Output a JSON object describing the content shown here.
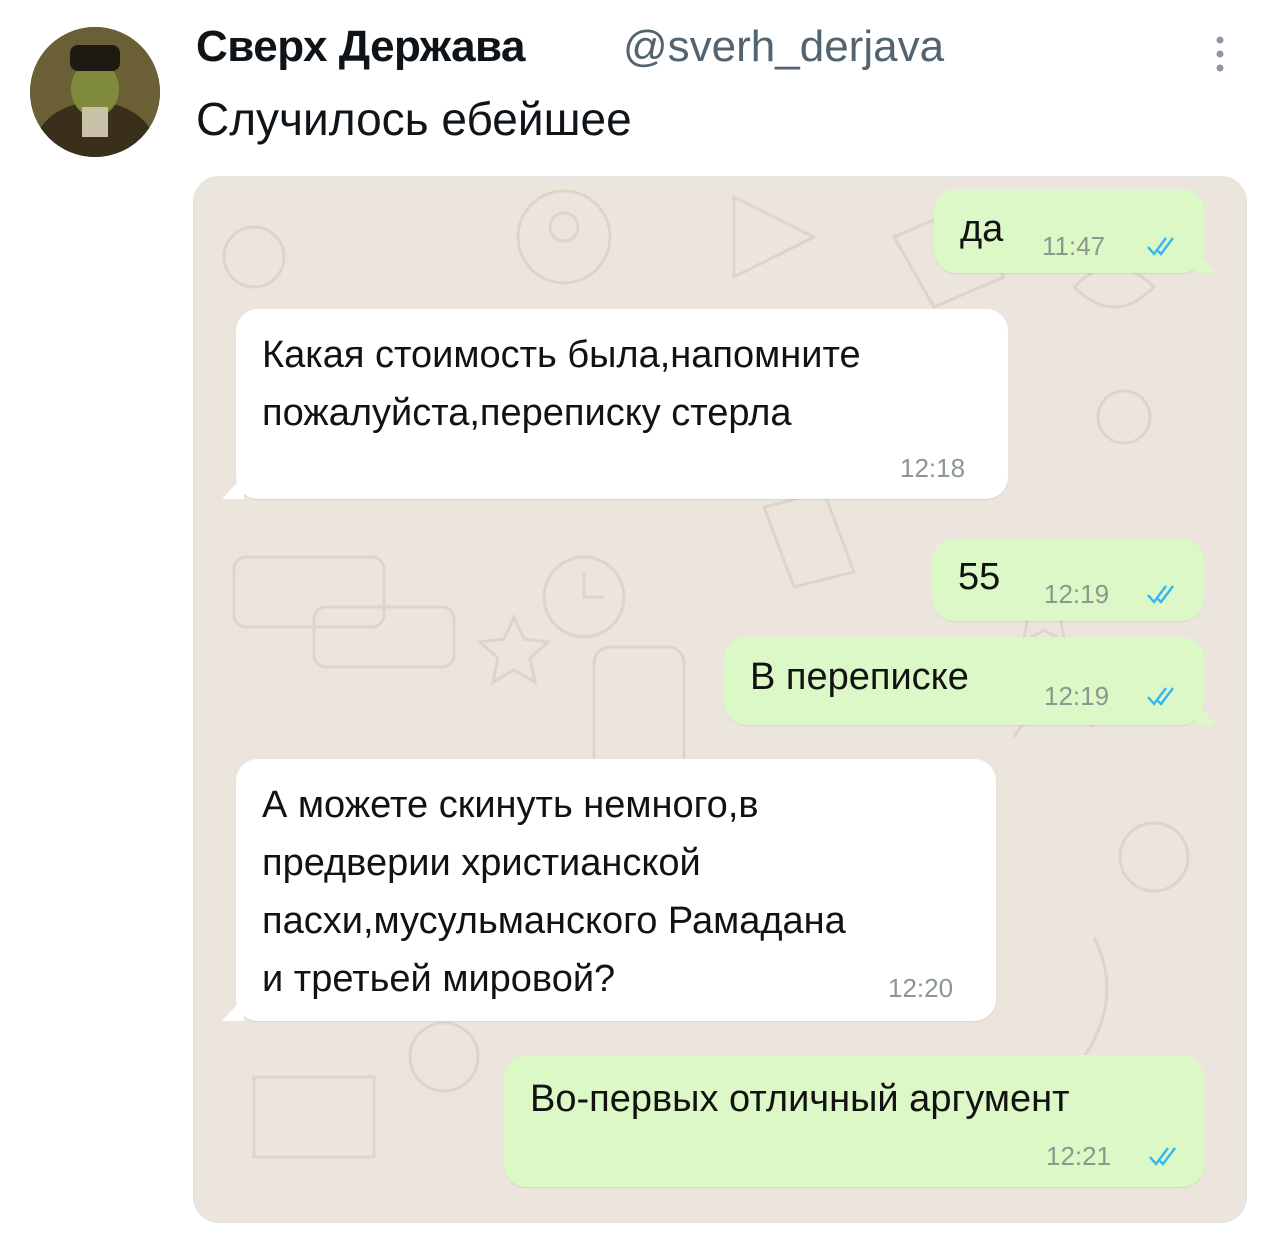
{
  "tweet": {
    "author_name": "Сверх Держава",
    "author_handle": "@sverh_derjava",
    "text": "Случилось ебейшее"
  },
  "chat": {
    "messages": [
      {
        "direction": "outgoing",
        "text": "да",
        "time": "11:47",
        "read": true
      },
      {
        "direction": "incoming",
        "lines": [
          "Какая стоимость была,напомните",
          "пожалуйста,переписку стерла"
        ],
        "time": "12:18"
      },
      {
        "direction": "outgoing",
        "text": "55",
        "time": "12:19",
        "read": true
      },
      {
        "direction": "outgoing",
        "text": "В переписке",
        "time": "12:19",
        "read": true
      },
      {
        "direction": "incoming",
        "lines": [
          "А можете скинуть немного,в",
          "предверии христианской",
          "пасхи,мусульманского Рамадана",
          "и третьей мировой?"
        ],
        "time": "12:20"
      },
      {
        "direction": "outgoing",
        "text": "Во-первых отличный аргумент",
        "time": "12:21",
        "read": true
      }
    ]
  },
  "colors": {
    "outgoing_bubble": "#dcf8c6",
    "incoming_bubble": "#ffffff",
    "read_tick": "#34b7f1",
    "wallpaper": "#ebe5dd"
  },
  "icons": [
    "more-options-icon",
    "double-check-icon"
  ]
}
